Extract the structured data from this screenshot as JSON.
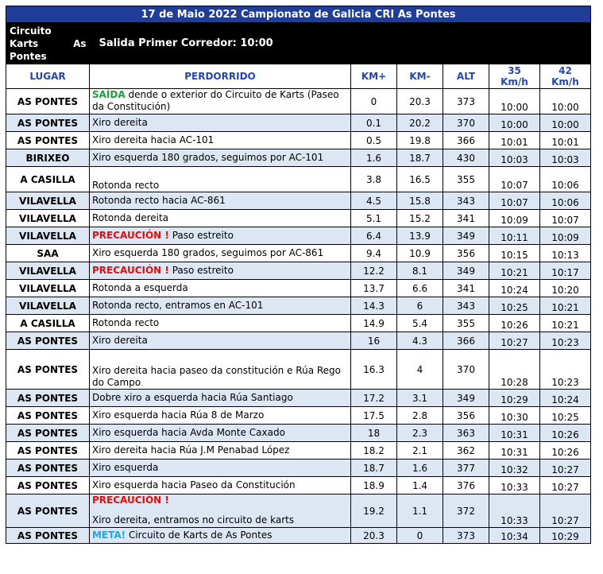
{
  "title": "17 de Maio 2022 Campionato de Galicia CRI As Pontes",
  "start": {
    "place_line1": "Circuito",
    "place_word_a": "Karts",
    "place_word_b": "As",
    "place_line3": "Pontes",
    "text": "Salida Primer Corredor: 10:00"
  },
  "headers": {
    "lugar": "LUGAR",
    "perdorrido": "PERDORRIDO",
    "km_plus": "KM+",
    "km_minus": "KM-",
    "alt": "ALT",
    "s35_a": "35",
    "s35_b": "Km/h",
    "s42_a": "42",
    "s42_b": "Km/h"
  },
  "rows": [
    {
      "lugar": "AS PONTES",
      "pre": "SAÍDA",
      "pre_color": "green",
      "desc": " dende o exterior do Circuito de Karts (Paseo da Constitución)",
      "km_plus": "0",
      "km_minus": "20.3",
      "alt": "373",
      "t35": "10:00",
      "t42": "10:00"
    },
    {
      "lugar": "AS PONTES",
      "pre": "",
      "pre_color": "",
      "desc": "Xiro dereita",
      "km_plus": "0.1",
      "km_minus": "20.2",
      "alt": "370",
      "t35": "10:00",
      "t42": "10:00"
    },
    {
      "lugar": "AS PONTES",
      "pre": "",
      "pre_color": "",
      "desc": "Xiro dereita hacia AC-101",
      "km_plus": "0.5",
      "km_minus": "19.8",
      "alt": "366",
      "t35": "10:01",
      "t42": "10:01"
    },
    {
      "lugar": "BIRIXEO",
      "pre": "",
      "pre_color": "",
      "desc": "Xiro esquerda 180 grados, seguimos por AC-101",
      "km_plus": "1.6",
      "km_minus": "18.7",
      "alt": "430",
      "t35": "10:03",
      "t42": "10:03"
    },
    {
      "lugar": "A CASILLA",
      "pre": "",
      "pre_color": "",
      "desc": "Rotonda recto",
      "km_plus": "3.8",
      "km_minus": "16.5",
      "alt": "355",
      "t35": "10:07",
      "t42": "10:06"
    },
    {
      "lugar": "VILAVELLA",
      "pre": "",
      "pre_color": "",
      "desc": "Rotonda recto hacia AC-861",
      "km_plus": "4.5",
      "km_minus": "15.8",
      "alt": "343",
      "t35": "10:07",
      "t42": "10:06"
    },
    {
      "lugar": "VILAVELLA",
      "pre": "",
      "pre_color": "",
      "desc": "Rotonda dereita",
      "km_plus": "5.1",
      "km_minus": "15.2",
      "alt": "341",
      "t35": "10:09",
      "t42": "10:07"
    },
    {
      "lugar": "VILAVELLA",
      "pre": "PRECAUCIÓN  !",
      "pre_color": "red",
      "desc": " Paso estreito",
      "km_plus": "6.4",
      "km_minus": "13.9",
      "alt": "349",
      "t35": "10:11",
      "t42": "10:09"
    },
    {
      "lugar": "SAA",
      "pre": "",
      "pre_color": "",
      "desc": "Xiro esquerda 180 grados, seguimos por AC-861",
      "km_plus": "9.4",
      "km_minus": "10.9",
      "alt": "356",
      "t35": "10:15",
      "t42": "10:13"
    },
    {
      "lugar": "VILAVELLA",
      "pre": "PRECAUCIÓN  !",
      "pre_color": "red",
      "desc": " Paso estreito",
      "km_plus": "12.2",
      "km_minus": "8.1",
      "alt": "349",
      "t35": "10:21",
      "t42": "10:17"
    },
    {
      "lugar": "VILAVELLA",
      "pre": "",
      "pre_color": "",
      "desc": "Rotonda a esquerda",
      "km_plus": "13.7",
      "km_minus": "6.6",
      "alt": "341",
      "t35": "10:24",
      "t42": "10:20"
    },
    {
      "lugar": "VILAVELLA",
      "pre": "",
      "pre_color": "",
      "desc": "Rotonda recto, entramos en AC-101",
      "km_plus": "14.3",
      "km_minus": "6",
      "alt": "343",
      "t35": "10:25",
      "t42": "10:21"
    },
    {
      "lugar": "A CASILLA",
      "pre": "",
      "pre_color": "",
      "desc": "Rotonda recto",
      "km_plus": "14.9",
      "km_minus": "5.4",
      "alt": "355",
      "t35": "10:26",
      "t42": "10:21"
    },
    {
      "lugar": "AS PONTES",
      "pre": "",
      "pre_color": "",
      "desc": "Xiro dereita",
      "km_plus": "16",
      "km_minus": "4.3",
      "alt": "366",
      "t35": "10:27",
      "t42": "10:23"
    },
    {
      "lugar": "AS PONTES",
      "pre": "",
      "pre_color": "",
      "desc": "Xiro dereita hacia paseo da constitución e Rúa Rego do Campo",
      "km_plus": "16.3",
      "km_minus": "4",
      "alt": "370",
      "t35": "10:28",
      "t42": "10:23"
    },
    {
      "lugar": "AS PONTES",
      "pre": "",
      "pre_color": "",
      "desc": "Dobre xiro a esquerda hacia Rúa Santiago",
      "km_plus": "17.2",
      "km_minus": "3.1",
      "alt": "349",
      "t35": "10:29",
      "t42": "10:24"
    },
    {
      "lugar": "AS PONTES",
      "pre": "",
      "pre_color": "",
      "desc": "Xiro esquerda hacia Rúa 8 de Marzo",
      "km_plus": "17.5",
      "km_minus": "2.8",
      "alt": "356",
      "t35": "10:30",
      "t42": "10:25"
    },
    {
      "lugar": "AS PONTES",
      "pre": "",
      "pre_color": "",
      "desc": "Xiro esquerda hacia Avda Monte Caxado",
      "km_plus": "18",
      "km_minus": "2.3",
      "alt": "363",
      "t35": "10:31",
      "t42": "10:26"
    },
    {
      "lugar": "AS PONTES",
      "pre": "",
      "pre_color": "",
      "desc": "Xiro dereita hacia Rúa J.M Penabad López",
      "km_plus": "18.2",
      "km_minus": "2.1",
      "alt": "362",
      "t35": "10:31",
      "t42": "10:26"
    },
    {
      "lugar": "AS PONTES",
      "pre": "",
      "pre_color": "",
      "desc": "Xiro esquerda",
      "km_plus": "18.7",
      "km_minus": "1.6",
      "alt": "377",
      "t35": "10:32",
      "t42": "10:27"
    },
    {
      "lugar": "AS PONTES",
      "pre": "",
      "pre_color": "",
      "desc": "Xiro esquerda hacia Paseo da Constitución",
      "km_plus": "18.9",
      "km_minus": "1.4",
      "alt": "376",
      "t35": "10:33",
      "t42": "10:27"
    },
    {
      "lugar": "AS PONTES",
      "pre": "PRECAUCIÓN  !",
      "pre_color": "red",
      "desc": "Xiro dereita, entramos no circuito de karts",
      "km_plus": "19.2",
      "km_minus": "1.1",
      "alt": "372",
      "t35": "10:33",
      "t42": "10:27"
    },
    {
      "lugar": "AS PONTES",
      "pre": "META!",
      "pre_color": "cyan",
      "desc": " Circuito de Karts de As Pontes",
      "km_plus": "20.3",
      "km_minus": "0",
      "alt": "373",
      "t35": "10:34",
      "t42": "10:29"
    }
  ]
}
